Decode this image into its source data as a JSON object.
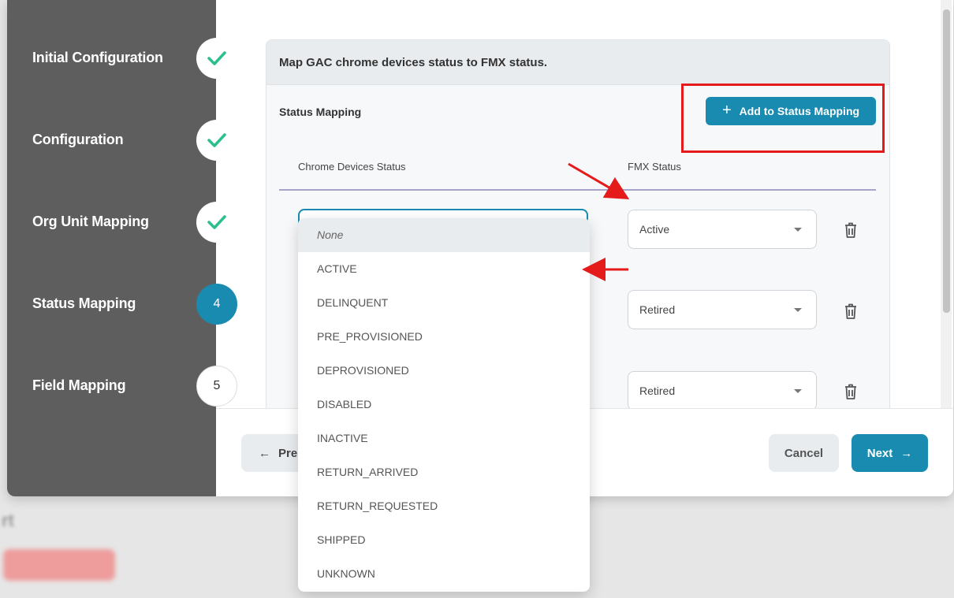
{
  "background": {
    "blur_text": "rt",
    "blur_button": ""
  },
  "steps": [
    {
      "label": "Initial Configuration",
      "state": "done"
    },
    {
      "label": "Configuration",
      "state": "done"
    },
    {
      "label": "Org Unit Mapping",
      "state": "done"
    },
    {
      "label": "Status Mapping",
      "state": "active",
      "number": "4"
    },
    {
      "label": "Field Mapping",
      "state": "todo",
      "number": "5"
    }
  ],
  "card": {
    "title": "Map GAC chrome devices status to FMX status.",
    "section_title": "Status Mapping",
    "add_button_label": "Add to Status Mapping",
    "columns": {
      "chrome": "Chrome Devices Status",
      "fmx": "FMX Status"
    }
  },
  "rows": [
    {
      "fmx_value": "Active"
    },
    {
      "fmx_value": "Retired"
    },
    {
      "fmx_value": "Retired"
    }
  ],
  "dropdown": {
    "options": [
      "None",
      "ACTIVE",
      "DELINQUENT",
      "PRE_PROVISIONED",
      "DEPROVISIONED",
      "DISABLED",
      "INACTIVE",
      "RETURN_ARRIVED",
      "RETURN_REQUESTED",
      "SHIPPED",
      "UNKNOWN"
    ]
  },
  "footer": {
    "prev_label": "Pre",
    "cancel_label": "Cancel",
    "next_label": "Next"
  },
  "colors": {
    "accent": "#1a8bb0",
    "sidebar": "#5e5e5e",
    "check": "#2bbf8c",
    "annotation": "#e51a1a"
  }
}
